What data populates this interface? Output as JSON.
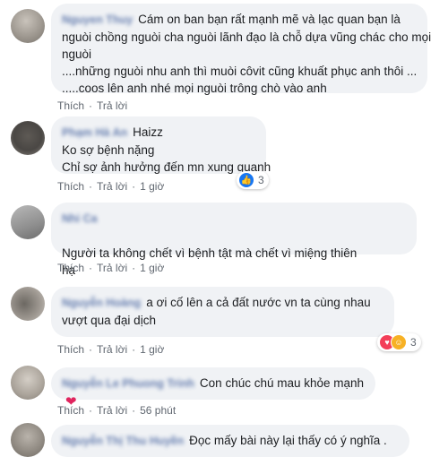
{
  "actions": {
    "like": "Thích",
    "reply": "Trả lời"
  },
  "comments": [
    {
      "name": "Nguyen Thuy",
      "lines": [
        "Cám on ban bạn rất mạnh mẽ và lạc quan bạn là",
        "nguòi chồng nguòi cha nguòi lãnh đạo là chỗ dựa vũng chác cho mọi",
        "nguòi",
        "....những nguòi nhu anh thì muòi côvit cũng khuất phục anh thôi ...",
        ".....coos lên anh nhé mọi nguòi trông chò vào anh"
      ],
      "time": ""
    },
    {
      "name": "Phạm Hà An",
      "lines": [
        "Haizz",
        "Ko sợ bệnh nặng",
        "Chỉ sợ ảnh hưởng đến mn xung quanh"
      ],
      "time": "1 giờ",
      "reaction_count": "3"
    },
    {
      "name": "Nhi Ca",
      "lines": [
        "Người ta không chết vì bệnh tật mà chết vì miệng thiên",
        "hạ"
      ],
      "time": "1 giờ"
    },
    {
      "name": "Nguyễn Hoàng",
      "lines": [
        "a ơi cố lên a cả đất nước vn ta cùng nhau",
        "vượt qua đại dịch"
      ],
      "time": "1 giờ",
      "reaction_count": "3"
    },
    {
      "name": "Nguyễn Le Phuong Trinh",
      "lines": [
        "Con chúc chú mau khỏe mạnh"
      ],
      "time": "56 phút"
    },
    {
      "name": "Nguyễn Thị Thu Huyền",
      "lines": [
        "Đọc mấy bài này lại thấy có ý nghĩa ."
      ],
      "time": ""
    }
  ]
}
